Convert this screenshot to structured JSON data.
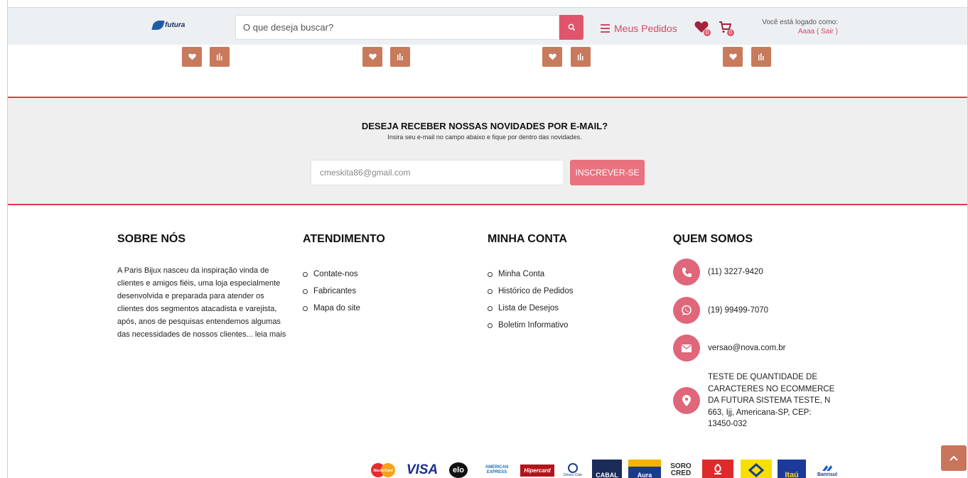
{
  "header": {
    "logo_text": "futura",
    "search_placeholder": "O que deseja buscar?",
    "orders_label": "Meus Pedidos",
    "wishlist_count": "0",
    "cart_count": "0",
    "logged_label": "Você está logado como:",
    "user_name": "Aaaa",
    "logout_label": "( Sair )"
  },
  "newsletter": {
    "title": "DESEJA RECEBER NOSSAS NOVIDADES POR E-MAIL?",
    "subtitle": "Insira seu e-mail no campo abaixo e fique por dentro das novidades.",
    "email_value": "cmeskita86@gmail.com",
    "button_label": "INSCREVER-SE"
  },
  "footer": {
    "about": {
      "title": "SOBRE NÓS",
      "text": "A Paris Bijux nasceu da inspiração vinda de clientes e amigos fiéis, uma loja especialmente desenvolvida e preparada para atender os clientes dos segmentos atacadista e varejista, após, anos de pesquisas entendemos algumas das necessidades de nossos clientes... leia mais"
    },
    "service": {
      "title": "ATENDIMENTO",
      "links": [
        "Contate-nos",
        "Fabricantes",
        "Mapa do site"
      ]
    },
    "account": {
      "title": "MINHA CONTA",
      "links": [
        "Minha Conta",
        "Histórico de Pedidos",
        "Lista de Desejos",
        "Boletim Informativo"
      ]
    },
    "who": {
      "title": "QUEM SOMOS",
      "phone": "(11) 3227-9420",
      "whatsapp": "(19) 99499-7070",
      "email": "versao@nova.com.br",
      "address": "TESTE DE QUANTIDADE DE CARACTERES NO ECOMMERCE DA FUTURA SISTEMA TESTE, N 663, Ijj, Americana-SP, CEP: 13450-032"
    }
  },
  "payments": {
    "mastercard": "MasterCard",
    "visa": "VISA",
    "elo": "elo",
    "amex": "AMERICAN EXPRESS",
    "hipercard": "Hipercard",
    "diners": "Diners Club",
    "cabal": "CABAL",
    "aura": "Aura",
    "sorocred": "SORO CRED",
    "banco_brasil": "",
    "itau": "Itaú",
    "banrisul": "Banrisul"
  },
  "colors": {
    "accent": "#e0556c",
    "action_button": "#c77a5c",
    "newsletter_border": "#e63a4a"
  }
}
